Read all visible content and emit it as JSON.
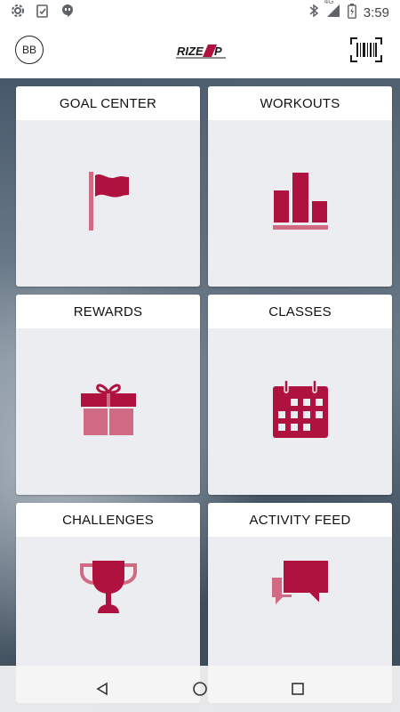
{
  "status_bar": {
    "time": "3:59",
    "network_label": "4G",
    "icons": [
      "settings-icon",
      "clipboard-check-icon",
      "hangouts-icon",
      "bluetooth-icon",
      "signal-icon",
      "battery-icon"
    ]
  },
  "header": {
    "avatar_initials": "BB",
    "logo_text": "RIZE UP",
    "barcode_icon": "barcode-scan-icon"
  },
  "tiles": [
    {
      "label": "GOAL CENTER",
      "icon": "flag-icon"
    },
    {
      "label": "WORKOUTS",
      "icon": "bar-chart-icon"
    },
    {
      "label": "REWARDS",
      "icon": "gift-icon"
    },
    {
      "label": "CLASSES",
      "icon": "calendar-icon"
    },
    {
      "label": "CHALLENGES",
      "icon": "trophy-icon"
    },
    {
      "label": "ACTIVITY FEED",
      "icon": "chat-bubbles-icon"
    }
  ],
  "nav_bar": {
    "icons": [
      "back-icon",
      "home-icon",
      "recents-icon"
    ]
  },
  "colors": {
    "accent": "#b0123f",
    "accent_light": "#d16b84"
  }
}
